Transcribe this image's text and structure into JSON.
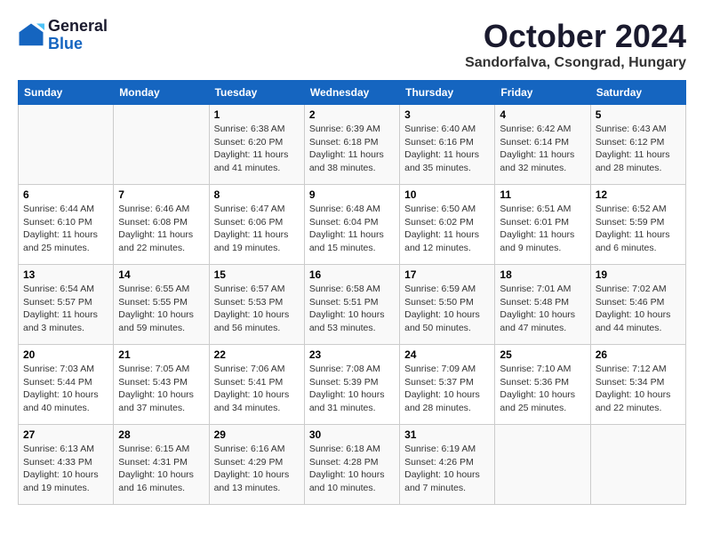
{
  "header": {
    "logo_line1": "General",
    "logo_line2": "Blue",
    "month_title": "October 2024",
    "location": "Sandorfalva, Csongrad, Hungary"
  },
  "days_of_week": [
    "Sunday",
    "Monday",
    "Tuesday",
    "Wednesday",
    "Thursday",
    "Friday",
    "Saturday"
  ],
  "weeks": [
    [
      {
        "num": "",
        "sunrise": "",
        "sunset": "",
        "daylight": ""
      },
      {
        "num": "",
        "sunrise": "",
        "sunset": "",
        "daylight": ""
      },
      {
        "num": "1",
        "sunrise": "Sunrise: 6:38 AM",
        "sunset": "Sunset: 6:20 PM",
        "daylight": "Daylight: 11 hours and 41 minutes."
      },
      {
        "num": "2",
        "sunrise": "Sunrise: 6:39 AM",
        "sunset": "Sunset: 6:18 PM",
        "daylight": "Daylight: 11 hours and 38 minutes."
      },
      {
        "num": "3",
        "sunrise": "Sunrise: 6:40 AM",
        "sunset": "Sunset: 6:16 PM",
        "daylight": "Daylight: 11 hours and 35 minutes."
      },
      {
        "num": "4",
        "sunrise": "Sunrise: 6:42 AM",
        "sunset": "Sunset: 6:14 PM",
        "daylight": "Daylight: 11 hours and 32 minutes."
      },
      {
        "num": "5",
        "sunrise": "Sunrise: 6:43 AM",
        "sunset": "Sunset: 6:12 PM",
        "daylight": "Daylight: 11 hours and 28 minutes."
      }
    ],
    [
      {
        "num": "6",
        "sunrise": "Sunrise: 6:44 AM",
        "sunset": "Sunset: 6:10 PM",
        "daylight": "Daylight: 11 hours and 25 minutes."
      },
      {
        "num": "7",
        "sunrise": "Sunrise: 6:46 AM",
        "sunset": "Sunset: 6:08 PM",
        "daylight": "Daylight: 11 hours and 22 minutes."
      },
      {
        "num": "8",
        "sunrise": "Sunrise: 6:47 AM",
        "sunset": "Sunset: 6:06 PM",
        "daylight": "Daylight: 11 hours and 19 minutes."
      },
      {
        "num": "9",
        "sunrise": "Sunrise: 6:48 AM",
        "sunset": "Sunset: 6:04 PM",
        "daylight": "Daylight: 11 hours and 15 minutes."
      },
      {
        "num": "10",
        "sunrise": "Sunrise: 6:50 AM",
        "sunset": "Sunset: 6:02 PM",
        "daylight": "Daylight: 11 hours and 12 minutes."
      },
      {
        "num": "11",
        "sunrise": "Sunrise: 6:51 AM",
        "sunset": "Sunset: 6:01 PM",
        "daylight": "Daylight: 11 hours and 9 minutes."
      },
      {
        "num": "12",
        "sunrise": "Sunrise: 6:52 AM",
        "sunset": "Sunset: 5:59 PM",
        "daylight": "Daylight: 11 hours and 6 minutes."
      }
    ],
    [
      {
        "num": "13",
        "sunrise": "Sunrise: 6:54 AM",
        "sunset": "Sunset: 5:57 PM",
        "daylight": "Daylight: 11 hours and 3 minutes."
      },
      {
        "num": "14",
        "sunrise": "Sunrise: 6:55 AM",
        "sunset": "Sunset: 5:55 PM",
        "daylight": "Daylight: 10 hours and 59 minutes."
      },
      {
        "num": "15",
        "sunrise": "Sunrise: 6:57 AM",
        "sunset": "Sunset: 5:53 PM",
        "daylight": "Daylight: 10 hours and 56 minutes."
      },
      {
        "num": "16",
        "sunrise": "Sunrise: 6:58 AM",
        "sunset": "Sunset: 5:51 PM",
        "daylight": "Daylight: 10 hours and 53 minutes."
      },
      {
        "num": "17",
        "sunrise": "Sunrise: 6:59 AM",
        "sunset": "Sunset: 5:50 PM",
        "daylight": "Daylight: 10 hours and 50 minutes."
      },
      {
        "num": "18",
        "sunrise": "Sunrise: 7:01 AM",
        "sunset": "Sunset: 5:48 PM",
        "daylight": "Daylight: 10 hours and 47 minutes."
      },
      {
        "num": "19",
        "sunrise": "Sunrise: 7:02 AM",
        "sunset": "Sunset: 5:46 PM",
        "daylight": "Daylight: 10 hours and 44 minutes."
      }
    ],
    [
      {
        "num": "20",
        "sunrise": "Sunrise: 7:03 AM",
        "sunset": "Sunset: 5:44 PM",
        "daylight": "Daylight: 10 hours and 40 minutes."
      },
      {
        "num": "21",
        "sunrise": "Sunrise: 7:05 AM",
        "sunset": "Sunset: 5:43 PM",
        "daylight": "Daylight: 10 hours and 37 minutes."
      },
      {
        "num": "22",
        "sunrise": "Sunrise: 7:06 AM",
        "sunset": "Sunset: 5:41 PM",
        "daylight": "Daylight: 10 hours and 34 minutes."
      },
      {
        "num": "23",
        "sunrise": "Sunrise: 7:08 AM",
        "sunset": "Sunset: 5:39 PM",
        "daylight": "Daylight: 10 hours and 31 minutes."
      },
      {
        "num": "24",
        "sunrise": "Sunrise: 7:09 AM",
        "sunset": "Sunset: 5:37 PM",
        "daylight": "Daylight: 10 hours and 28 minutes."
      },
      {
        "num": "25",
        "sunrise": "Sunrise: 7:10 AM",
        "sunset": "Sunset: 5:36 PM",
        "daylight": "Daylight: 10 hours and 25 minutes."
      },
      {
        "num": "26",
        "sunrise": "Sunrise: 7:12 AM",
        "sunset": "Sunset: 5:34 PM",
        "daylight": "Daylight: 10 hours and 22 minutes."
      }
    ],
    [
      {
        "num": "27",
        "sunrise": "Sunrise: 6:13 AM",
        "sunset": "Sunset: 4:33 PM",
        "daylight": "Daylight: 10 hours and 19 minutes."
      },
      {
        "num": "28",
        "sunrise": "Sunrise: 6:15 AM",
        "sunset": "Sunset: 4:31 PM",
        "daylight": "Daylight: 10 hours and 16 minutes."
      },
      {
        "num": "29",
        "sunrise": "Sunrise: 6:16 AM",
        "sunset": "Sunset: 4:29 PM",
        "daylight": "Daylight: 10 hours and 13 minutes."
      },
      {
        "num": "30",
        "sunrise": "Sunrise: 6:18 AM",
        "sunset": "Sunset: 4:28 PM",
        "daylight": "Daylight: 10 hours and 10 minutes."
      },
      {
        "num": "31",
        "sunrise": "Sunrise: 6:19 AM",
        "sunset": "Sunset: 4:26 PM",
        "daylight": "Daylight: 10 hours and 7 minutes."
      },
      {
        "num": "",
        "sunrise": "",
        "sunset": "",
        "daylight": ""
      },
      {
        "num": "",
        "sunrise": "",
        "sunset": "",
        "daylight": ""
      }
    ]
  ]
}
